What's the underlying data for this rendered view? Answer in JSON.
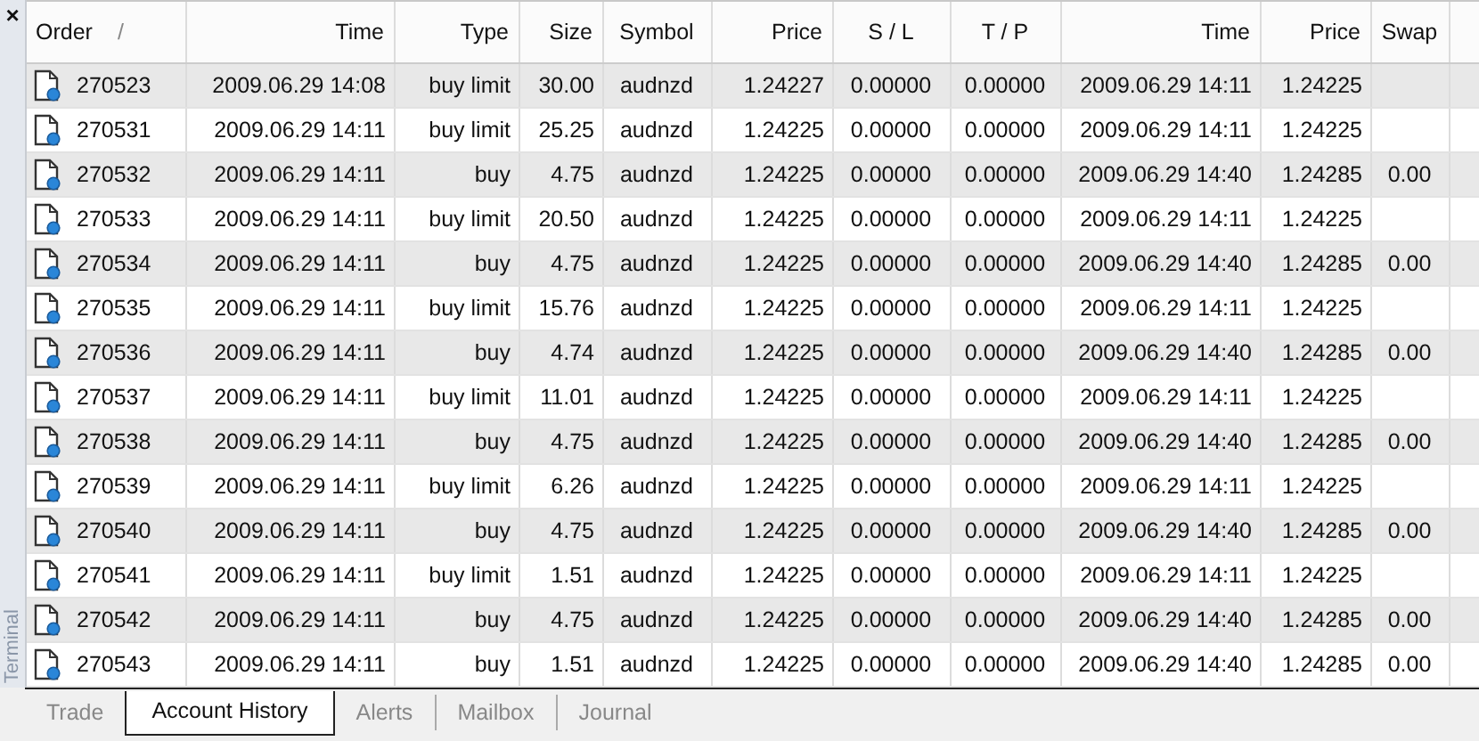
{
  "panel": {
    "close": "×",
    "title": "Terminal"
  },
  "table": {
    "columns": [
      {
        "label": "Order",
        "sort_mark": "/"
      },
      {
        "label": "Time"
      },
      {
        "label": "Type"
      },
      {
        "label": "Size"
      },
      {
        "label": "Symbol"
      },
      {
        "label": "Price"
      },
      {
        "label": "S / L"
      },
      {
        "label": "T / P"
      },
      {
        "label": "Time"
      },
      {
        "label": "Price"
      },
      {
        "label": "Swap"
      }
    ],
    "rows": [
      {
        "cells": [
          "270523",
          "2009.06.29 14:08",
          "buy limit",
          "30.00",
          "audnzd",
          "1.24227",
          "0.00000",
          "0.00000",
          "2009.06.29 14:11",
          "1.24225"
        ]
      },
      {
        "cells": [
          "270531",
          "2009.06.29 14:11",
          "buy limit",
          "25.25",
          "audnzd",
          "1.24225",
          "0.00000",
          "0.00000",
          "2009.06.29 14:11",
          "1.24225"
        ]
      },
      {
        "cells": [
          "270532",
          "2009.06.29 14:11",
          "buy",
          "4.75",
          "audnzd",
          "1.24225",
          "0.00000",
          "0.00000",
          "2009.06.29 14:40",
          "1.24285",
          "0.00"
        ]
      },
      {
        "cells": [
          "270533",
          "2009.06.29 14:11",
          "buy limit",
          "20.50",
          "audnzd",
          "1.24225",
          "0.00000",
          "0.00000",
          "2009.06.29 14:11",
          "1.24225"
        ]
      },
      {
        "cells": [
          "270534",
          "2009.06.29 14:11",
          "buy",
          "4.75",
          "audnzd",
          "1.24225",
          "0.00000",
          "0.00000",
          "2009.06.29 14:40",
          "1.24285",
          "0.00"
        ]
      },
      {
        "cells": [
          "270535",
          "2009.06.29 14:11",
          "buy limit",
          "15.76",
          "audnzd",
          "1.24225",
          "0.00000",
          "0.00000",
          "2009.06.29 14:11",
          "1.24225"
        ]
      },
      {
        "cells": [
          "270536",
          "2009.06.29 14:11",
          "buy",
          "4.74",
          "audnzd",
          "1.24225",
          "0.00000",
          "0.00000",
          "2009.06.29 14:40",
          "1.24285",
          "0.00"
        ]
      },
      {
        "cells": [
          "270537",
          "2009.06.29 14:11",
          "buy limit",
          "11.01",
          "audnzd",
          "1.24225",
          "0.00000",
          "0.00000",
          "2009.06.29 14:11",
          "1.24225"
        ]
      },
      {
        "cells": [
          "270538",
          "2009.06.29 14:11",
          "buy",
          "4.75",
          "audnzd",
          "1.24225",
          "0.00000",
          "0.00000",
          "2009.06.29 14:40",
          "1.24285",
          "0.00"
        ]
      },
      {
        "cells": [
          "270539",
          "2009.06.29 14:11",
          "buy limit",
          "6.26",
          "audnzd",
          "1.24225",
          "0.00000",
          "0.00000",
          "2009.06.29 14:11",
          "1.24225"
        ]
      },
      {
        "cells": [
          "270540",
          "2009.06.29 14:11",
          "buy",
          "4.75",
          "audnzd",
          "1.24225",
          "0.00000",
          "0.00000",
          "2009.06.29 14:40",
          "1.24285",
          "0.00"
        ]
      },
      {
        "cells": [
          "270541",
          "2009.06.29 14:11",
          "buy limit",
          "1.51",
          "audnzd",
          "1.24225",
          "0.00000",
          "0.00000",
          "2009.06.29 14:11",
          "1.24225"
        ]
      },
      {
        "cells": [
          "270542",
          "2009.06.29 14:11",
          "buy",
          "4.75",
          "audnzd",
          "1.24225",
          "0.00000",
          "0.00000",
          "2009.06.29 14:40",
          "1.24285",
          "0.00"
        ]
      },
      {
        "cells": [
          "270543",
          "2009.06.29 14:11",
          "buy",
          "1.51",
          "audnzd",
          "1.24225",
          "0.00000",
          "0.00000",
          "2009.06.29 14:40",
          "1.24285",
          "0.00"
        ]
      }
    ]
  },
  "tabs": [
    {
      "label": "Trade",
      "selected": false
    },
    {
      "label": "Account History",
      "selected": true
    },
    {
      "label": "Alerts",
      "selected": false
    },
    {
      "label": "Mailbox",
      "selected": false
    },
    {
      "label": "Journal",
      "selected": false
    }
  ]
}
